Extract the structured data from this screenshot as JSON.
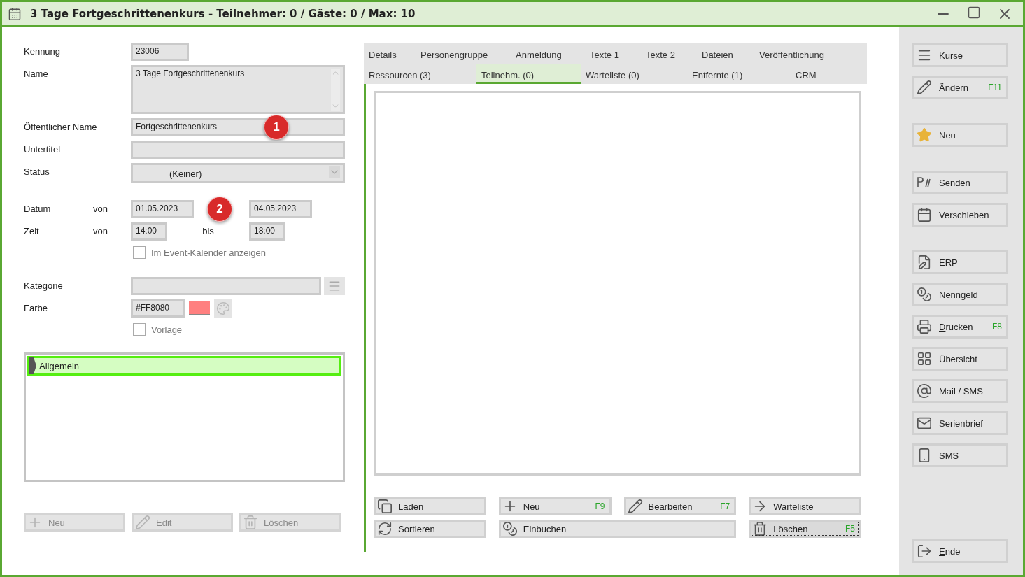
{
  "window": {
    "title": "3 Tage Fortgeschrittenenkurs - Teilnehmer: 0 / Gäste: 0 / Max: 10"
  },
  "form": {
    "sections": [
      [
        {
          "kind": "short",
          "label": "Kennung",
          "value": "23006"
        },
        {
          "kind": "textarea",
          "label": "Name",
          "value": "3 Tage Fortgeschrittenenkurs"
        },
        {
          "kind": "input",
          "label": "Öffentlicher Name",
          "value": "Fortgeschrittenenkurs",
          "badge": "1"
        },
        {
          "kind": "input",
          "label": "Untertitel"
        },
        {
          "kind": "select",
          "label": "Status",
          "value": "(Keiner)"
        }
      ],
      [
        {
          "kind": "date_range",
          "label": "Datum",
          "from_label": "von",
          "from": "01.05.2023",
          "to": "04.05.2023",
          "badge": "2"
        },
        {
          "kind": "time_range",
          "label": "Zeit",
          "from_label": "von",
          "from": "14:00",
          "to_label": "bis",
          "to": "18:00"
        },
        {
          "kind": "checkbox",
          "label": "Im Event-Kalender anzeigen",
          "checked": false
        }
      ],
      [
        {
          "kind": "picker",
          "label": "Kategorie"
        },
        {
          "kind": "color",
          "label": "Farbe",
          "value": "#FF8080",
          "color": "#ff8080"
        },
        {
          "kind": "checkbox",
          "label": "Vorlage",
          "checked": false
        }
      ]
    ]
  },
  "groups": [
    {
      "label": "Allgemein",
      "selected": true
    }
  ],
  "group_buttons": [
    {
      "label": "Neu",
      "disabled": true
    },
    {
      "label": "Edit",
      "disabled": true
    },
    {
      "label": "Löschen",
      "disabled": true
    }
  ],
  "tabs": [
    [
      {
        "label": "Details",
        "selected": false
      },
      {
        "label": "Personengruppe",
        "selected": false
      },
      {
        "label": "Anmeldung",
        "selected": false
      },
      {
        "label": "Texte 1",
        "selected": false
      },
      {
        "label": "Texte 2",
        "selected": false
      },
      {
        "label": "Dateien",
        "selected": false
      },
      {
        "label": "Veröffentlichung",
        "selected": false
      }
    ],
    [
      {
        "label": "Ressourcen (3)",
        "selected": false
      },
      {
        "label": "Teilnehm. (0)",
        "selected": true
      },
      {
        "label": "Warteliste (0)",
        "selected": false
      },
      {
        "label": "Entfernte (1)",
        "selected": false
      },
      {
        "label": "CRM",
        "selected": false
      }
    ]
  ],
  "actions": [
    {
      "label": "Laden",
      "focused": false
    },
    {
      "label": "Neu",
      "shortcut": "F9",
      "focused": false
    },
    {
      "label": "Bearbeiten",
      "shortcut": "F7",
      "focused": false
    },
    {
      "label": "Warteliste",
      "focused": false
    },
    {
      "label": "Sortieren",
      "focused": false
    },
    {
      "label": "Einbuchen",
      "focused": false
    },
    {
      "label": "Löschen",
      "shortcut": "F5",
      "focused": true
    }
  ],
  "sidebar": {
    "groups": [
      [
        {
          "label": "Kurse",
          "mnemonic": false
        },
        {
          "label": "Ändern",
          "shortcut": "F11",
          "mnemonic": true
        }
      ],
      [
        {
          "label": "Neu",
          "mnemonic": false
        }
      ],
      [
        {
          "label": "Senden",
          "mnemonic": false
        },
        {
          "label": "Verschieben",
          "mnemonic": false
        }
      ],
      [
        {
          "label": "ERP",
          "mnemonic": false
        },
        {
          "label": "Nenngeld",
          "mnemonic": false
        },
        {
          "label": "Drucken",
          "shortcut": "F8",
          "mnemonic": true
        },
        {
          "label": "Übersicht",
          "mnemonic": false
        },
        {
          "label": "Mail / SMS",
          "mnemonic": false
        },
        {
          "label": "Serienbrief",
          "mnemonic": false
        },
        {
          "label": "SMS",
          "mnemonic": false
        }
      ]
    ],
    "end": {
      "label": "Ende",
      "mnemonic": true
    }
  }
}
